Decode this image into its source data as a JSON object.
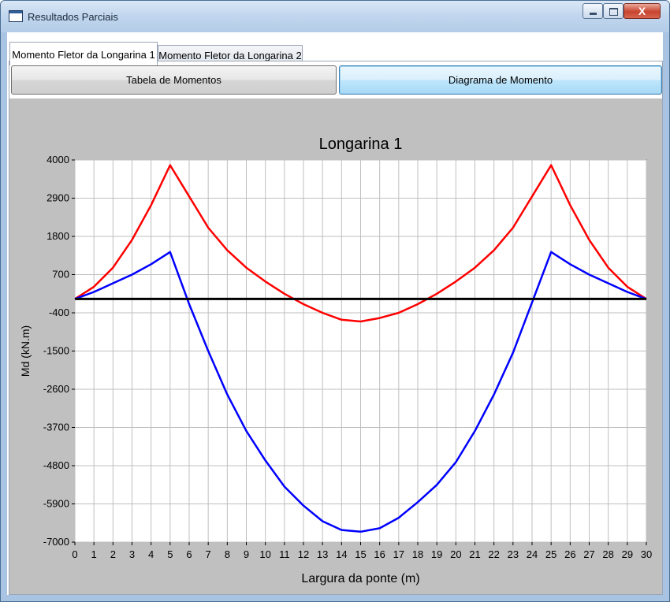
{
  "window": {
    "title": "Resultados Parciais",
    "close_glyph": "X"
  },
  "tabs": [
    {
      "label": "Momento Fletor da Longarina 1",
      "selected": true
    },
    {
      "label": "Momento Fletor da Longarina 2",
      "selected": false
    }
  ],
  "panel_buttons": {
    "table": "Tabela de Momentos",
    "diagram": "Diagrama de Momento"
  },
  "colors": {
    "chart_background": "#c0c0c0",
    "plot_background": "#ffffff",
    "grid": "#bfbfbf",
    "zero_line": "#000000",
    "series_upper": "#ff0000",
    "series_lower": "#0000ff"
  },
  "chart_data": {
    "type": "line",
    "title": "Longarina 1",
    "xlabel": "Largura da ponte (m)",
    "ylabel": "Md (kN.m)",
    "xlim": [
      0,
      30
    ],
    "ylim": [
      -7000,
      4000
    ],
    "xticks": [
      0,
      1,
      2,
      3,
      4,
      5,
      6,
      7,
      8,
      9,
      10,
      11,
      12,
      13,
      14,
      15,
      16,
      17,
      18,
      19,
      20,
      21,
      22,
      23,
      24,
      25,
      26,
      27,
      28,
      29,
      30
    ],
    "yticks": [
      4000,
      2900,
      1800,
      700,
      -400,
      -1500,
      -2600,
      -3700,
      -4800,
      -5900,
      -7000
    ],
    "grid": true,
    "legend": "none",
    "series": [
      {
        "color": "#ff0000",
        "x": [
          0,
          1,
          2,
          3,
          4,
          5,
          6,
          7,
          8,
          9,
          10,
          11,
          12,
          13,
          14,
          15,
          16,
          17,
          18,
          19,
          20,
          21,
          22,
          23,
          24,
          25,
          26,
          27,
          28,
          29,
          30
        ],
        "y": [
          0,
          350,
          900,
          1700,
          2700,
          3850,
          2950,
          2050,
          1400,
          900,
          500,
          150,
          -150,
          -400,
          -600,
          -650,
          -550,
          -400,
          -150,
          150,
          500,
          900,
          1400,
          2050,
          2950,
          3850,
          2700,
          1700,
          900,
          350,
          0
        ]
      },
      {
        "color": "#0000ff",
        "x": [
          0,
          1,
          2,
          3,
          4,
          5,
          6,
          7,
          8,
          9,
          10,
          11,
          12,
          13,
          14,
          15,
          16,
          17,
          18,
          19,
          20,
          21,
          22,
          23,
          24,
          25,
          26,
          27,
          28,
          29,
          30
        ],
        "y": [
          0,
          200,
          450,
          700,
          1000,
          1350,
          -150,
          -1500,
          -2750,
          -3800,
          -4650,
          -5400,
          -5950,
          -6400,
          -6650,
          -6700,
          -6600,
          -6300,
          -5850,
          -5350,
          -4700,
          -3800,
          -2750,
          -1550,
          -100,
          1350,
          1000,
          700,
          450,
          200,
          0
        ]
      }
    ],
    "reference_line_y": 0
  }
}
